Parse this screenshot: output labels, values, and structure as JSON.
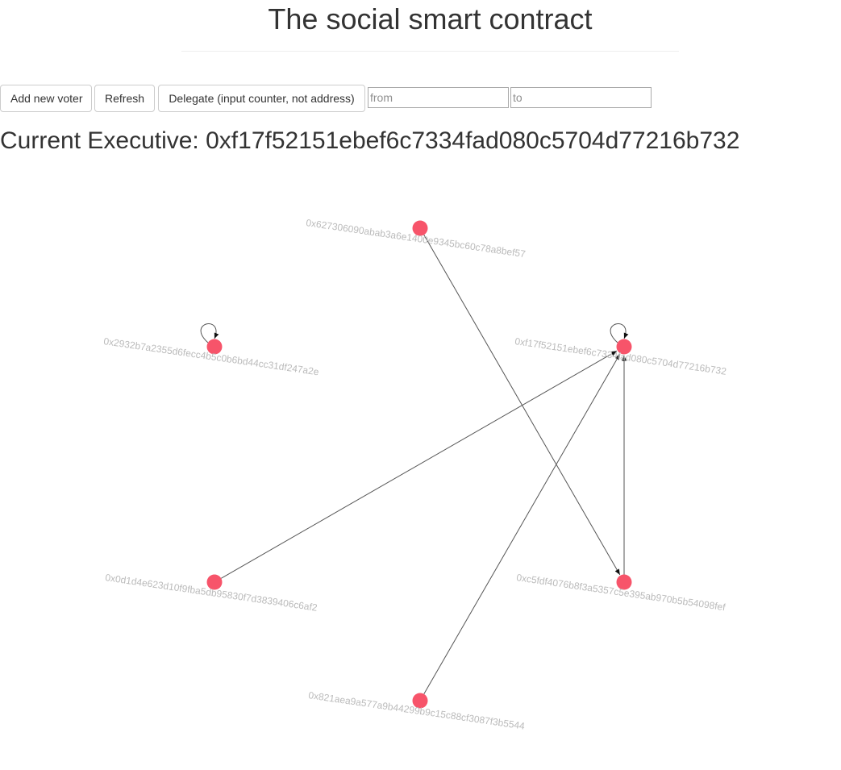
{
  "header": {
    "title": "The social smart contract"
  },
  "toolbar": {
    "add_voter_label": "Add new voter",
    "refresh_label": "Refresh",
    "delegate_label": "Delegate (input counter, not address)",
    "from_placeholder": "from",
    "to_placeholder": "to",
    "from_value": "",
    "to_value": ""
  },
  "executive": {
    "prefix": "Current Executive: ",
    "address": "0xf17f52151ebef6c7334fad080c5704d77216b732"
  },
  "graph": {
    "node_color": "#f7546a",
    "edge_color": "#555555",
    "nodes": [
      {
        "id": "0x627306090abab3a6e1400e9345bc60c78a8bef57"
      },
      {
        "id": "0x2932b7a2355d6fecc4b5c0b6bd44cc31df247a2e"
      },
      {
        "id": "0xf17f52151ebef6c7334fad080c5704d77216b732"
      },
      {
        "id": "0x0d1d4e623d10f9fba5db95830f7d3839406c6af2"
      },
      {
        "id": "0xc5fdf4076b8f3a5357c5e395ab970b5b54098fef"
      },
      {
        "id": "0x821aea9a577a9b44299b9c15c88cf3087f3b5544"
      }
    ],
    "edges": [
      {
        "from": "0x627306090abab3a6e1400e9345bc60c78a8bef57",
        "to": "0xc5fdf4076b8f3a5357c5e395ab970b5b54098fef"
      },
      {
        "from": "0x2932b7a2355d6fecc4b5c0b6bd44cc31df247a2e",
        "to": "0x2932b7a2355d6fecc4b5c0b6bd44cc31df247a2e"
      },
      {
        "from": "0xf17f52151ebef6c7334fad080c5704d77216b732",
        "to": "0xf17f52151ebef6c7334fad080c5704d77216b732"
      },
      {
        "from": "0x0d1d4e623d10f9fba5db95830f7d3839406c6af2",
        "to": "0xf17f52151ebef6c7334fad080c5704d77216b732"
      },
      {
        "from": "0xc5fdf4076b8f3a5357c5e395ab970b5b54098fef",
        "to": "0xf17f52151ebef6c7334fad080c5704d77216b732"
      },
      {
        "from": "0x821aea9a577a9b44299b9c15c88cf3087f3b5544",
        "to": "0xf17f52151ebef6c7334fad080c5704d77216b732"
      }
    ]
  }
}
